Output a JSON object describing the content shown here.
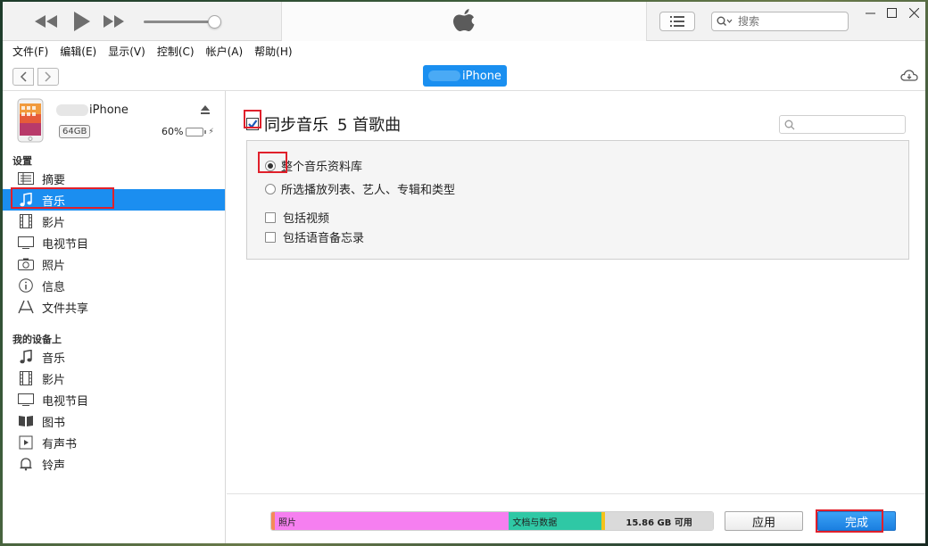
{
  "titlebar": {
    "search_placeholder": "搜索",
    "window_controls": [
      "minimize-icon",
      "maximize-icon",
      "close-icon"
    ]
  },
  "menu": [
    "文件(F)",
    "编辑(E)",
    "显示(V)",
    "控制(C)",
    "帐户(A)",
    "帮助(H)"
  ],
  "navbar": {
    "device_label": "iPhone"
  },
  "device": {
    "name": "iPhone",
    "capacity": "64GB",
    "battery": "60%",
    "battery_level": 0.6
  },
  "sidebar": {
    "settings_title": "设置",
    "settings_items": [
      {
        "label": "摘要",
        "icon": "summary-icon"
      },
      {
        "label": "音乐",
        "icon": "music-note-icon",
        "selected": true
      },
      {
        "label": "影片",
        "icon": "film-icon"
      },
      {
        "label": "电视节目",
        "icon": "tv-icon"
      },
      {
        "label": "照片",
        "icon": "camera-icon"
      },
      {
        "label": "信息",
        "icon": "info-icon"
      },
      {
        "label": "文件共享",
        "icon": "app-store-icon"
      }
    ],
    "ondevice_title": "我的设备上",
    "ondevice_items": [
      {
        "label": "音乐",
        "icon": "music-note-icon"
      },
      {
        "label": "影片",
        "icon": "film-icon"
      },
      {
        "label": "电视节目",
        "icon": "tv-icon"
      },
      {
        "label": "图书",
        "icon": "book-icon"
      },
      {
        "label": "有声书",
        "icon": "audiobook-icon"
      },
      {
        "label": "铃声",
        "icon": "bell-icon"
      }
    ]
  },
  "main": {
    "sync_title": "同步音乐",
    "song_count": "5 首歌曲",
    "options": {
      "entire_library": "整个音乐资料库",
      "selected": "所选播放列表、艺人、专辑和类型",
      "include_videos": "包括视频",
      "include_voice_memos": "包括语音备忘录"
    }
  },
  "storage": {
    "segments": [
      {
        "label": "",
        "color": "#f58a5a",
        "fraction": 0.008
      },
      {
        "label": "照片",
        "color": "#f67ff0",
        "fraction": 0.53
      },
      {
        "label": "文档与数据",
        "color": "#2fc8a5",
        "fraction": 0.21
      },
      {
        "label": "",
        "color": "#f5c21b",
        "fraction": 0.008
      },
      {
        "label": "15.86 GB 可用",
        "color": "#dadada",
        "fraction": 0.244
      }
    ],
    "apply_label": "应用",
    "done_label": "完成"
  },
  "colors": {
    "accent": "#1b8ef0",
    "highlight_box": "#e0202b"
  }
}
